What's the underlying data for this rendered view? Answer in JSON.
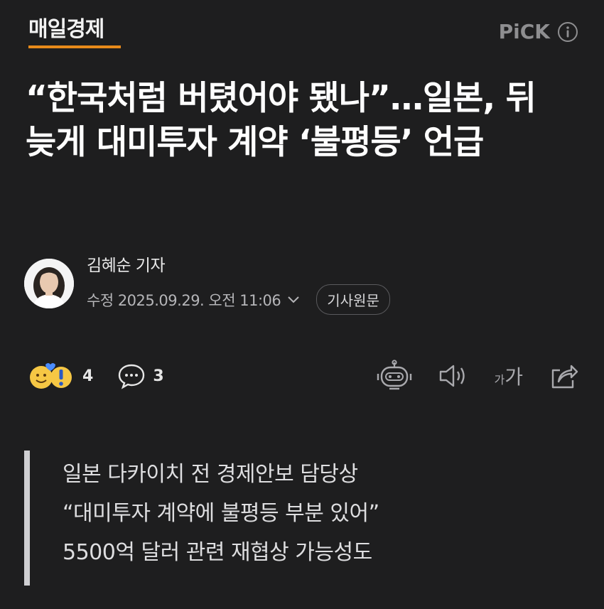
{
  "header": {
    "press_name": "매일경제",
    "pick_label": "PiCK",
    "accent_color": "#e88a1a"
  },
  "article": {
    "headline": "“한국처럼 버텼어야 됐나”…일본, 뒤늦게 대미투자 계약 ‘불평등’ 언급",
    "reporter": "김혜순 기자",
    "date": "수정 2025.09.29. 오전 11:06",
    "original_button": "기사원문"
  },
  "toolbar": {
    "reaction_count": "4",
    "comment_count": "3",
    "font_size_small": "가",
    "font_size_big": "가",
    "icons": [
      "reaction-emoji-icon",
      "comment-icon",
      "ai-robot-icon",
      "speaker-icon",
      "font-size-icon",
      "share-icon"
    ]
  },
  "summary": {
    "lines": [
      "일본 다카이치 전 경제안보 담당상",
      "“대미투자 계약에 불평등 부분 있어”",
      "5500억 달러 관련 재협상 가능성도"
    ]
  }
}
